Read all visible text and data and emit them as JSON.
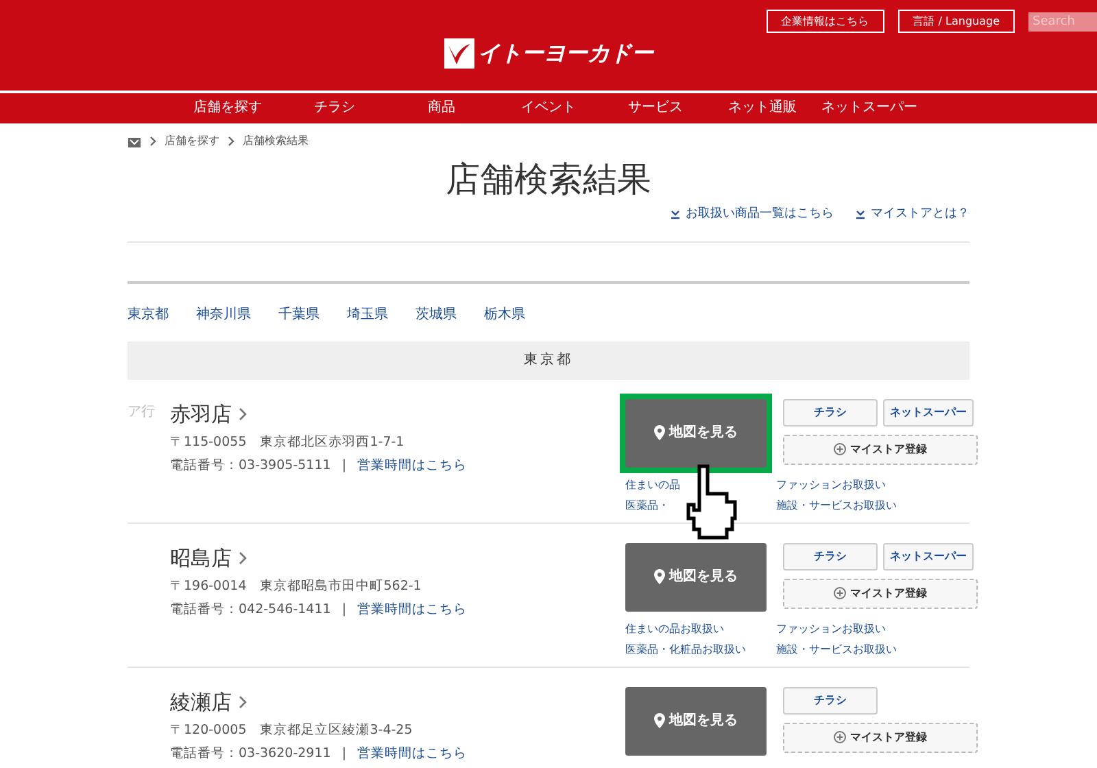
{
  "header": {
    "logo": "イトーヨーカドー",
    "top_links": [
      "企業情報はこちら",
      "言語 / Language"
    ],
    "search": {
      "placeholder": "Search"
    }
  },
  "nav": [
    "店舗を探す",
    "チラシ",
    "商品",
    "イベント",
    "サービス",
    "ネット通販",
    "ネットスーパー"
  ],
  "breadcrumb": [
    "店舗を探す",
    "店舗検索結果"
  ],
  "title": "店舗検索結果",
  "page_links": [
    "お取扱い商品一覧はこちら",
    "マイストアとは？"
  ],
  "prefectures": [
    "東京都",
    "神奈川県",
    "千葉県",
    "埼玉県",
    "茨城県",
    "栃木県"
  ],
  "region_heading": "東京都",
  "stores": [
    {
      "group_label": "ア行",
      "name": "赤羽店",
      "address": "〒115-0055　東京都北区赤羽西1-7-1",
      "phone": "電話番号：03-3905-5111",
      "separator": "|",
      "hours_link": "営業時間はこちら",
      "map_button": "地図を見る",
      "highlighted": true,
      "buttons": [
        "チラシ",
        "ネットスーパー"
      ],
      "mystore_button": "マイストア登録",
      "categories": [
        {
          "label": "住まいの品"
        },
        {
          "label": "ファッションお取扱い"
        },
        {
          "label": "医薬品・"
        },
        {
          "label": "施設・サービスお取扱い"
        }
      ]
    },
    {
      "name": "昭島店",
      "address": "〒196-0014　東京都昭島市田中町562-1",
      "phone": "電話番号：042-546-1411",
      "separator": "|",
      "hours_link": "営業時間はこちら",
      "map_button": "地図を見る",
      "highlighted": false,
      "buttons": [
        "チラシ",
        "ネットスーパー"
      ],
      "mystore_button": "マイストア登録",
      "categories": [
        {
          "label": "住まいの品お取扱い"
        },
        {
          "label": "ファッションお取扱い"
        },
        {
          "label": "医薬品・化粧品お取扱い"
        },
        {
          "label": "施設・サービスお取扱い"
        }
      ]
    },
    {
      "name": "綾瀬店",
      "address": "〒120-0005　東京都足立区綾瀬3-4-25",
      "phone": "電話番号：03-3620-2911",
      "separator": "|",
      "hours_link": "営業時間はこちら",
      "map_button": "地図を見る",
      "highlighted": false,
      "buttons": [
        "チラシ"
      ],
      "mystore_button": "マイストア登録"
    }
  ]
}
